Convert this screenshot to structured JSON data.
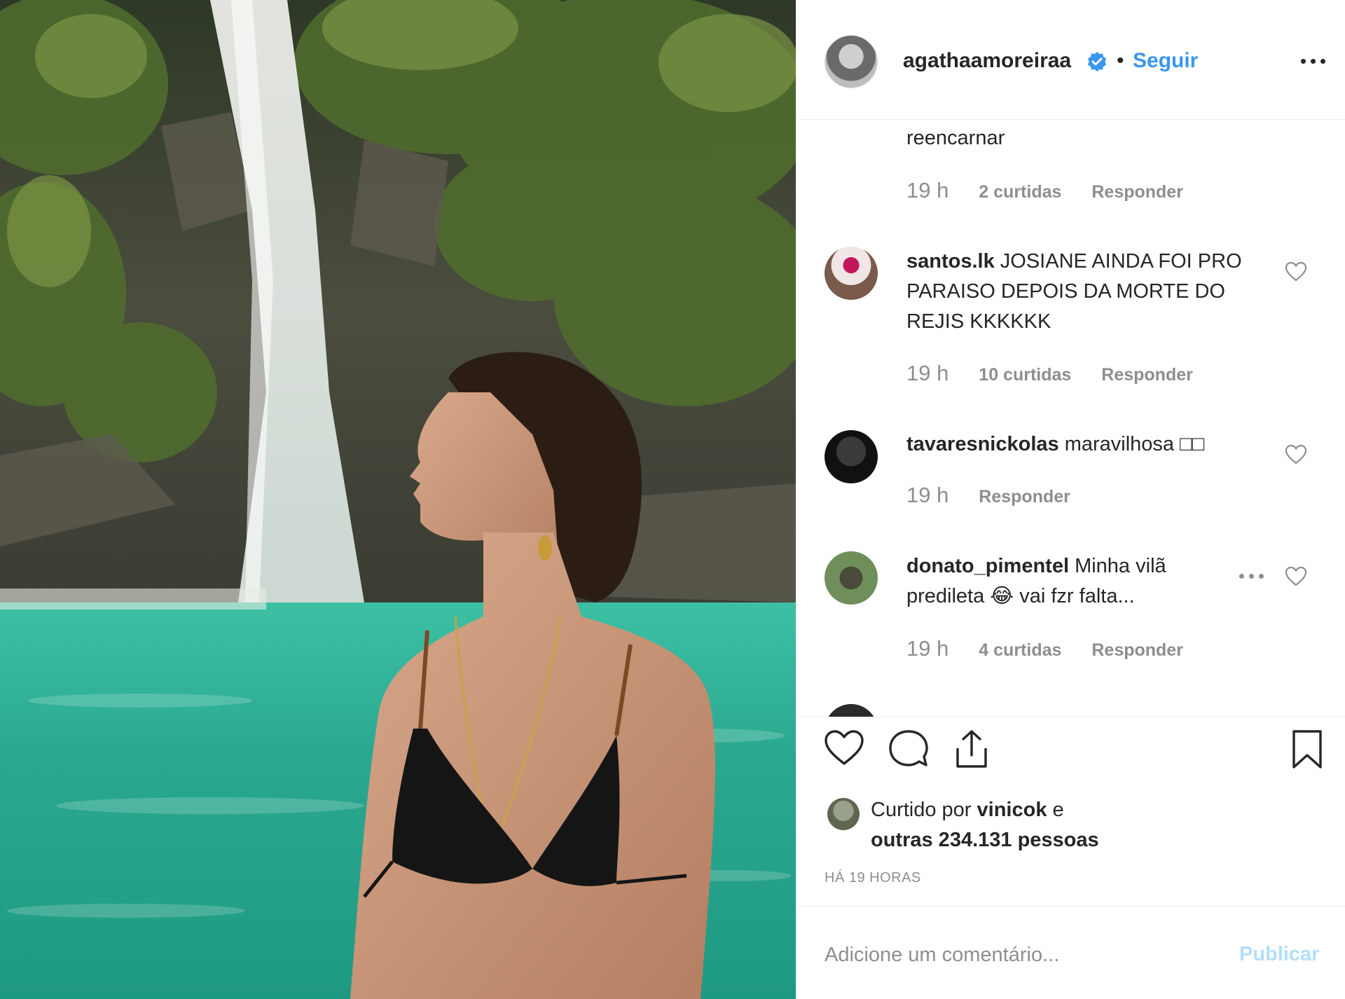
{
  "colors": {
    "link_blue": "#3897f0",
    "publish_disabled": "#b2dffc",
    "muted_gray": "#8e8e8e",
    "text_dark": "#262626",
    "water_turquoise": "#2fb59b"
  },
  "photo": {
    "description_icon": "photo"
  },
  "post_header": {
    "username": "agathaamoreiraa",
    "verified_icon": "verified-badge-icon",
    "separator": "•",
    "follow_label": "Seguir",
    "more_icon": "more-options-icon"
  },
  "comments": [
    {
      "username": "",
      "text": "reencarnar",
      "time": "19 h",
      "likes": "2 curtidas",
      "reply": "Responder"
    },
    {
      "username": "santos.lk",
      "text": "JOSIANE AINDA FOI PRO PARAISO DEPOIS DA MORTE DO REJIS KKKKKK",
      "time": "19 h",
      "likes": "10 curtidas",
      "reply": "Responder"
    },
    {
      "username": "tavaresnickolas",
      "text": "maravilhosa □□",
      "time": "19 h",
      "likes": "",
      "reply": "Responder"
    },
    {
      "username": "donato_pimentel",
      "text": "Minha vilã predileta 😂 vai fzr falta...",
      "time": "19 h",
      "likes": "4 curtidas",
      "reply": "Responder"
    }
  ],
  "actions": {
    "like_icon": "heart-icon",
    "comment_icon": "comment-icon",
    "share_icon": "share-icon",
    "save_icon": "bookmark-icon"
  },
  "likes_summary": {
    "prefix": "Curtido por",
    "user": "vinicok",
    "connector": "e",
    "others": "outras 234.131 pessoas"
  },
  "time_ago": "HÁ 19 HORAS",
  "add_comment": {
    "placeholder": "Adicione um comentário...",
    "publish_label": "Publicar"
  }
}
